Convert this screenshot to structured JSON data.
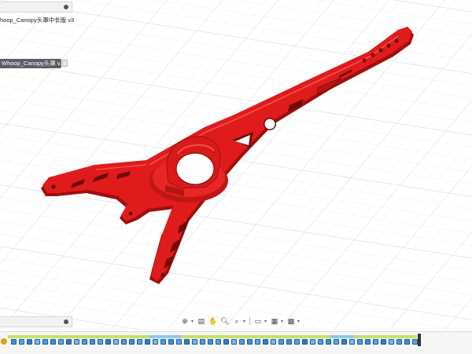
{
  "browser": {
    "design_title": "hoop_Canopy头罩中长版 v3",
    "component_label": "Whoop_Canopy头罩 v..."
  },
  "viewport": {
    "model": "red 3D-printed quadcopter canopy frame",
    "model_color": "#e01b1b",
    "grid_color": "#dcdcdc"
  },
  "nav_toolbar": {
    "items": [
      "orbit-icon",
      "look-at-icon",
      "pan-icon",
      "zoom-icon",
      "fit-icon",
      "display-settings-icon",
      "visual-style-icon",
      "grid-settings-icon"
    ]
  },
  "timeline": {
    "feature_count": 52
  }
}
